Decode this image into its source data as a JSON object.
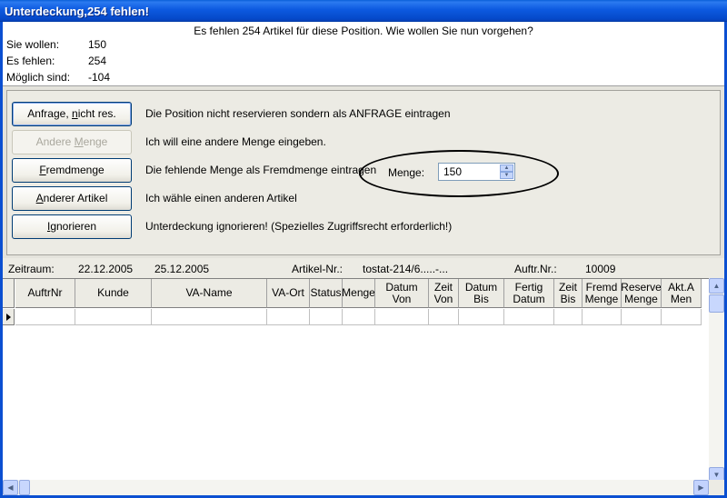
{
  "window": {
    "title": "Unterdeckung,254 fehlen!"
  },
  "header": {
    "message": "Es fehlen 254 Artikel für diese Position. Wie wollen Sie nun vorgehen?",
    "info": [
      {
        "label": "Sie wollen:",
        "value": "150"
      },
      {
        "label": "Es fehlen:",
        "value": "254"
      },
      {
        "label": "Möglich sind:",
        "value": "-104"
      }
    ]
  },
  "options": [
    {
      "button_pre": "Anfrage, ",
      "button_mnemonic": "n",
      "button_post": "icht res.",
      "text": "Die Position nicht reservieren sondern als ANFRAGE eintragen",
      "enabled": true
    },
    {
      "button_pre": "Andere ",
      "button_mnemonic": "M",
      "button_post": "enge",
      "text": "Ich will eine andere Menge eingeben.",
      "enabled": false
    },
    {
      "button_pre": "",
      "button_mnemonic": "F",
      "button_post": "remdmenge",
      "text": "Die fehlende Menge als Fremdmenge eintragen",
      "enabled": true
    },
    {
      "button_pre": "",
      "button_mnemonic": "A",
      "button_post": "nderer Artikel",
      "text": "Ich wähle einen anderen Artikel",
      "enabled": true
    },
    {
      "button_pre": "",
      "button_mnemonic": "I",
      "button_post": "gnorieren",
      "text": "Unterdeckung ignorieren! (Spezielles Zugriffsrecht erforderlich!)",
      "enabled": true
    }
  ],
  "menge": {
    "label": "Menge:",
    "value": "150"
  },
  "filter": {
    "zeitraum_label": "Zeitraum:",
    "date_from": "22.12.2005",
    "date_to": "25.12.2005",
    "artikel_label": "Artikel-Nr.:",
    "artikel_value": "tostat-214/6.....-...",
    "auftr_label": "Auftr.Nr.:",
    "auftr_value": "10009"
  },
  "grid": {
    "columns": [
      "AuftrNr",
      "Kunde",
      "VA-Name",
      "VA-Ort",
      "Status",
      "Menge",
      "Datum\nVon",
      "Zeit\nVon",
      "Datum\nBis",
      "Fertig\nDatum",
      "Zeit\nBis",
      "Fremd\nMenge",
      "Reserve\nMenge",
      "Akt.A\nMen"
    ]
  },
  "colors": {
    "titlebar": "#0549c9",
    "panel": "#ecebe4",
    "button_border": "#003c74"
  }
}
